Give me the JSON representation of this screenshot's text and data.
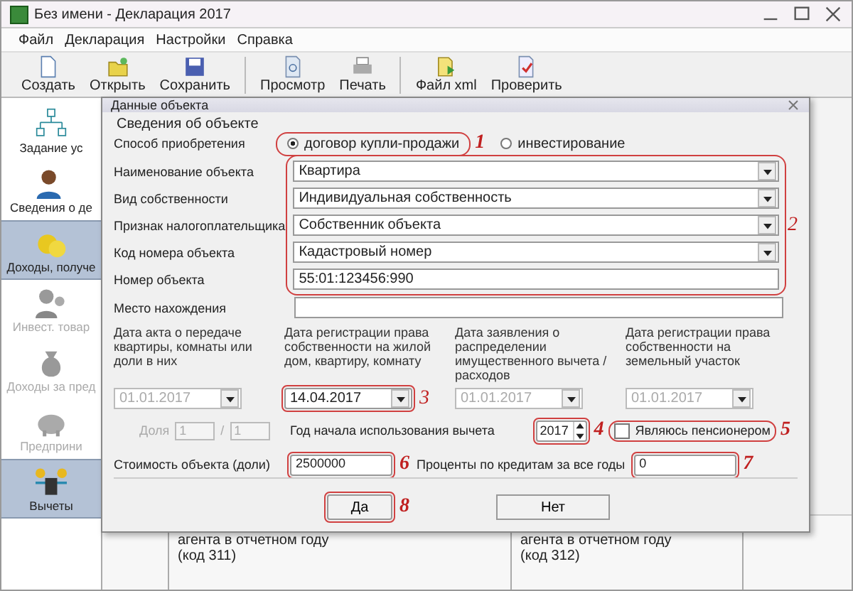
{
  "window": {
    "title": "Без имени - Декларация 2017"
  },
  "menu": [
    {
      "label": "Файл"
    },
    {
      "label": "Декларация"
    },
    {
      "label": "Настройки"
    },
    {
      "label": "Справка"
    }
  ],
  "toolbar": [
    {
      "label": "Создать",
      "kind": "new"
    },
    {
      "label": "Открыть",
      "kind": "open"
    },
    {
      "label": "Сохранить",
      "kind": "save"
    },
    {
      "label": "Просмотр",
      "kind": "preview"
    },
    {
      "label": "Печать",
      "kind": "print"
    },
    {
      "label": "Файл xml",
      "kind": "xml"
    },
    {
      "label": "Проверить",
      "kind": "check"
    }
  ],
  "sidebar": {
    "items": [
      {
        "label": "Задание ус",
        "kind": "tree",
        "selected": false,
        "disabled": false
      },
      {
        "label": "Сведения о де",
        "kind": "person",
        "selected": false,
        "disabled": false
      },
      {
        "label": "Доходы, получе",
        "kind": "coins",
        "selected": true,
        "disabled": false
      },
      {
        "label": "Инвест. товар",
        "kind": "people",
        "selected": false,
        "disabled": true
      },
      {
        "label": "Доходы за пред",
        "kind": "bag",
        "selected": false,
        "disabled": true
      },
      {
        "label": "Предприни",
        "kind": "piggy",
        "selected": false,
        "disabled": true
      },
      {
        "label": "Вычеты",
        "kind": "calc",
        "selected": true,
        "disabled": false
      }
    ]
  },
  "cells": [
    {
      "text": "агента в отчетном году"
    },
    {
      "text": "(код 311)"
    },
    {
      "text": "агента в отчетном году"
    },
    {
      "text": "(код 312)"
    }
  ],
  "dialog": {
    "title": "Данные объекта",
    "group_title": "Сведения об объекте",
    "acquisition": {
      "label": "Способ приобретения",
      "annotation": "1",
      "options": [
        {
          "label": "договор купли-продажи",
          "selected": true
        },
        {
          "label": "инвестирование",
          "selected": false
        }
      ]
    },
    "fields_annotation": "2",
    "fields": [
      {
        "label": "Наименование объекта",
        "kind": "combo",
        "value": "Квартира"
      },
      {
        "label": "Вид собственности",
        "kind": "combo",
        "value": "Индивидуальная собственность"
      },
      {
        "label": "Признак налогоплательщика",
        "kind": "combo",
        "value": "Собственник объекта"
      },
      {
        "label": "Код номера объекта",
        "kind": "combo",
        "value": "Кадастровый номер"
      },
      {
        "label": "Номер объекта",
        "kind": "text",
        "value": "55:01:123456:990"
      }
    ],
    "location": {
      "label": "Место нахождения"
    },
    "dates": [
      {
        "label": "Дата акта о передаче квартиры, комнаты или доли в них",
        "value": "01.01.2017",
        "disabled": true
      },
      {
        "label": "Дата регистрации права собственности на жилой дом, квартиру, комнату",
        "value": "14.04.2017",
        "disabled": false,
        "annotation": "3"
      },
      {
        "label": "Дата заявления о распределении имущественного вычета / расходов",
        "value": "01.01.2017",
        "disabled": true
      },
      {
        "label": "Дата регистрации права собственности на земельный участок",
        "value": "01.01.2017",
        "disabled": true
      }
    ],
    "share": {
      "label": "Доля",
      "numerator": "1",
      "separator": "/",
      "denominator": "1",
      "disabled": true
    },
    "start_year": {
      "label": "Год начала использования вычета",
      "value": "2017",
      "annotation": "4"
    },
    "pensioner": {
      "label": "Являюсь пенсионером",
      "checked": false,
      "annotation": "5"
    },
    "cost": {
      "label": "Стоимость объекта (доли)",
      "value": "2500000",
      "annotation": "6"
    },
    "interest": {
      "label": "Проценты по кредитам за все годы",
      "value": "0",
      "annotation": "7"
    },
    "buttons": [
      {
        "label": "Да",
        "annotation": "8"
      },
      {
        "label": "Нет"
      }
    ]
  }
}
